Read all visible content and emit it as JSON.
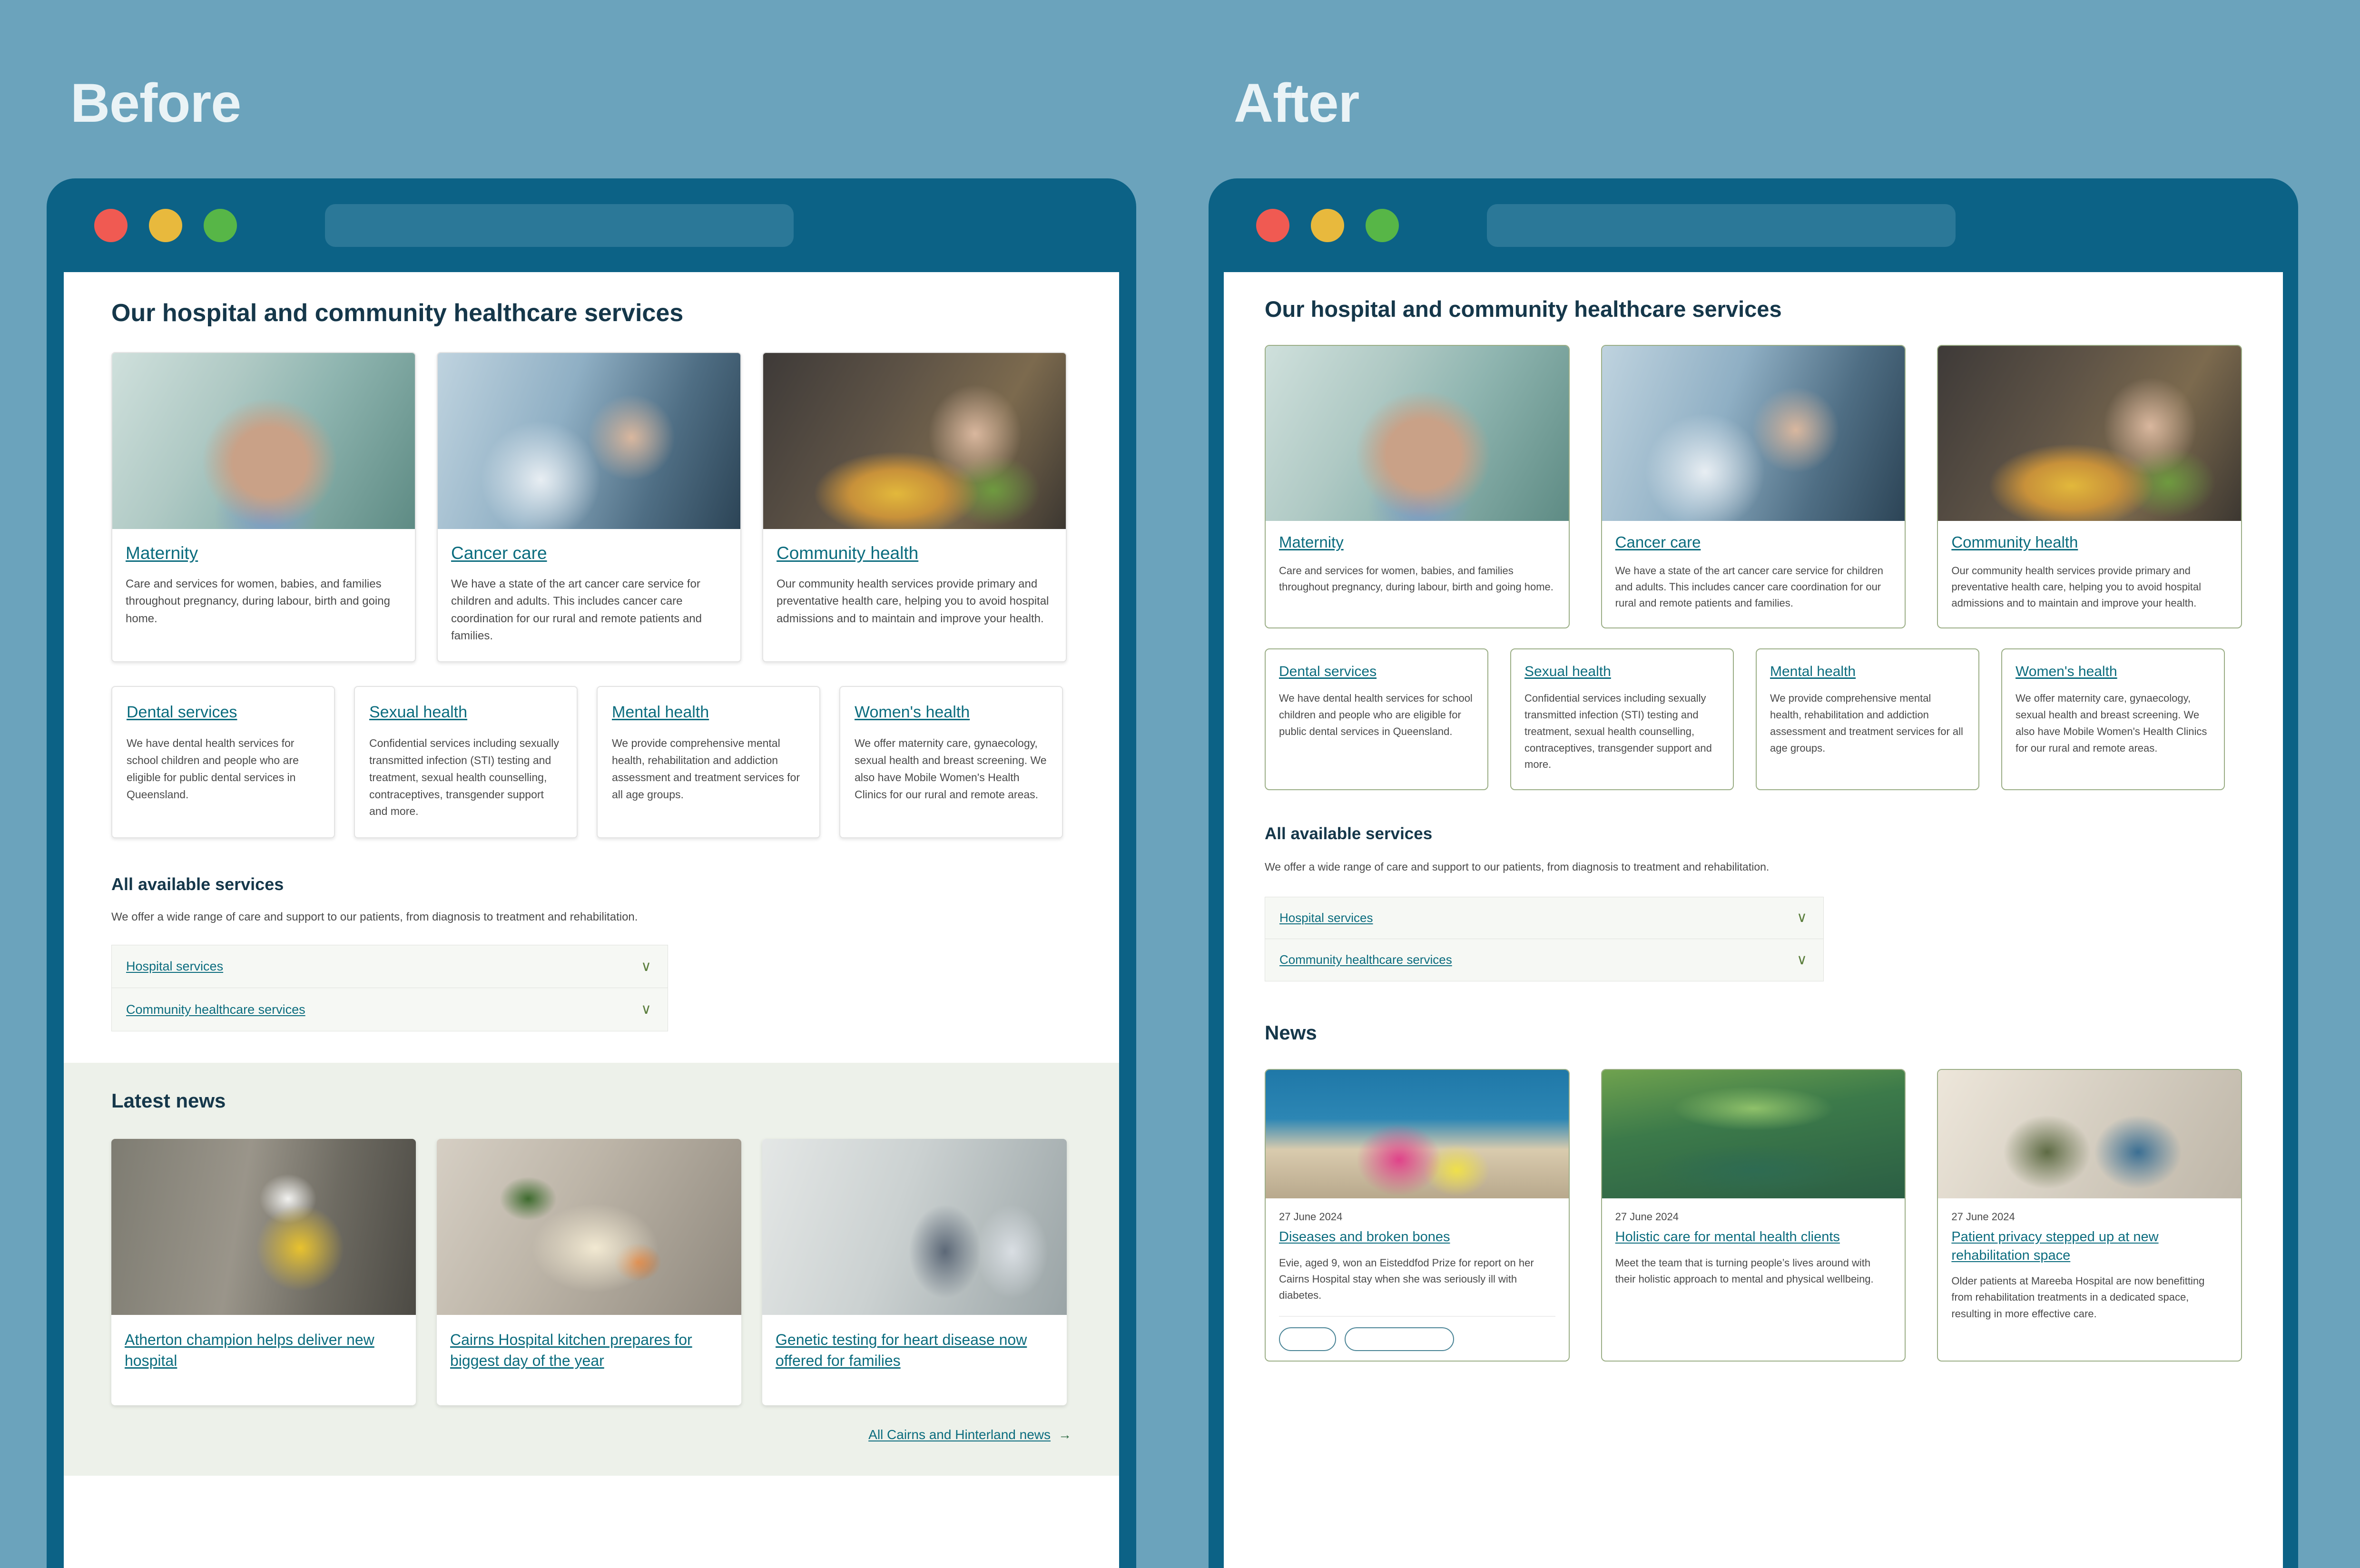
{
  "labels": {
    "before": "Before",
    "after": "After"
  },
  "page": {
    "services_heading": "Our hospital and community healthcare services",
    "all_services_heading": "All available services",
    "all_services_lede": "We offer a wide range of care and support to our patients, from diagnosis to treatment and rehabilitation.",
    "accordion": [
      {
        "label": "Hospital services",
        "chevron": "∨"
      },
      {
        "label": "Community healthcare services",
        "chevron": "∨"
      }
    ],
    "news_heading_before": "Latest news",
    "news_heading_after": "News",
    "all_news_link": "All Cairns and Hinterland news",
    "all_news_arrow": "→"
  },
  "service_cards": [
    {
      "title": "Maternity",
      "desc": "Care and services for women, babies, and families throughout pregnancy, during labour, birth and going home.",
      "photo": "ph-maternity"
    },
    {
      "title": "Cancer care",
      "desc": "We have a state of the art cancer care service for children and adults. This includes cancer care coordination for our rural and remote patients and families.",
      "photo": "ph-cancer"
    },
    {
      "title": "Community health",
      "desc": "Our community health services provide primary and preventative health care, helping you to avoid hospital admissions and to maintain and improve your health.",
      "photo": "ph-community"
    }
  ],
  "mini_cards": [
    {
      "title": "Dental services",
      "desc": "We have dental health services for school children and people who are eligible for public dental services in Queensland."
    },
    {
      "title": "Sexual health",
      "desc": "Confidential services including sexually transmitted infection (STI) testing and treatment, sexual health counselling, contraceptives, transgender support and more."
    },
    {
      "title": "Mental health",
      "desc": "We provide comprehensive mental health, rehabilitation and addiction assessment and treatment services for all age groups."
    },
    {
      "title": "Women's health",
      "desc": "We offer maternity care, gynaecology, sexual health and breast screening. We also have Mobile Women's Health Clinics for our rural and remote areas."
    }
  ],
  "news_before": [
    {
      "title": "Atherton champion helps deliver new hospital",
      "photo": "ph-atherton"
    },
    {
      "title": "Cairns Hospital kitchen prepares for biggest day of the year",
      "photo": "ph-kitchen"
    },
    {
      "title": "Genetic testing for heart disease now offered for families",
      "photo": "ph-genetic"
    }
  ],
  "news_after": [
    {
      "date": "27 June 2024",
      "title": "Diseases and broken bones",
      "desc": "Evie, aged 9, won an Eisteddfod Prize for report on her Cairns Hospital stay when she was seriously ill with diabetes.",
      "photo": "ph-diabetes",
      "tags": [
        "",
        ""
      ]
    },
    {
      "date": "27 June 2024",
      "title": "Holistic care for mental health clients",
      "desc": "Meet the team that is turning people’s lives around with their holistic approach to mental and physical wellbeing.",
      "photo": "ph-holistic",
      "tags": []
    },
    {
      "date": "27 June 2024",
      "title": "Patient privacy stepped up at new rehabilitation space",
      "desc": "Older patients at Mareeba Hospital are now benefitting from rehabilitation treatments in a dedicated space, resulting in more effective care.",
      "photo": "ph-privacy",
      "tags": []
    }
  ],
  "browser_chrome": {
    "dots": [
      "close-red",
      "minimize-yellow",
      "maximize-green"
    ],
    "url_value": ""
  },
  "colors": {
    "page_background": "#6BA3BC",
    "browser_frame": "#0C6286",
    "url_bar": "#2B7898",
    "link_teal": "#0B6C7E",
    "heading_navy": "#15374A",
    "after_card_border": "#9BAE86",
    "before_card_border": "#E3E3E3",
    "news_band_before": "#EDF1EA",
    "accordion_row": "#F6F8F4",
    "chevron_green": "#5C7F3E",
    "dot_red": "#F05A52",
    "dot_yellow": "#E8B93D",
    "dot_green": "#57B647"
  }
}
